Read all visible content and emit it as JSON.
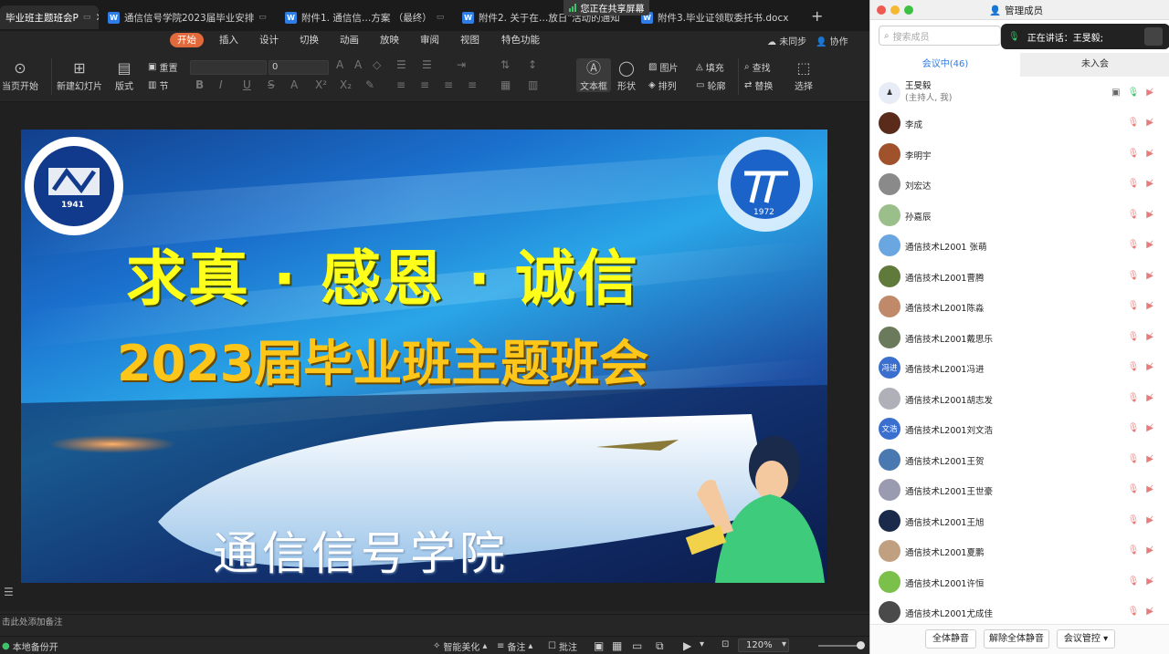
{
  "editor": {
    "tabs": [
      {
        "label": "毕业班主题班会P"
      },
      {
        "label": "通信信号学院2023届毕业安排"
      },
      {
        "label": "附件1. 通信信…方案 （最终）"
      },
      {
        "label": "附件2. 关于在…放日\"活动的通知"
      },
      {
        "label": "附件3.毕业证领取委托书.docx"
      }
    ],
    "share_badge": "您正在共享屏幕",
    "menu": [
      "开始",
      "插入",
      "设计",
      "切换",
      "动画",
      "放映",
      "审阅",
      "视图",
      "特色功能"
    ],
    "menu_right": {
      "sync": "未同步",
      "collab": "协作"
    },
    "ribbon": {
      "from_current": "当页开始",
      "new_slide": "新建幻灯片",
      "layout": "版式",
      "reset": "重置",
      "section": "节",
      "font_size": "0",
      "textbox": "文本框",
      "shape": "形状",
      "picture": "图片",
      "arrange": "排列",
      "fill": "填充",
      "outline": "轮廓",
      "find": "查找",
      "replace": "替换",
      "select": "选择"
    },
    "slide": {
      "title_big": "求真 · 感恩 · 诚信",
      "title_sub": "2023届毕业班主题班会",
      "college": "通信信号学院",
      "logo_left_year": "1941",
      "logo_right_year": "1972"
    },
    "notes_placeholder": "击此处添加备注",
    "status": {
      "backup": "本地备份开",
      "beautify": "智能美化",
      "notes": "备注",
      "comments": "批注",
      "zoom": "120%"
    }
  },
  "panel": {
    "title": "管理成员",
    "search_placeholder": "搜索成员",
    "speaking": "正在讲话：王旻毅;",
    "tab_in": "会议中(46)",
    "tab_out": "未入会",
    "host": {
      "name": "王旻毅",
      "role": "(主持人, 我)"
    },
    "members": [
      {
        "name": "李成",
        "avatar": "",
        "color": "#5a2a1a"
      },
      {
        "name": "李明宇",
        "avatar": "",
        "color": "#a0522d"
      },
      {
        "name": "刘宏达",
        "avatar": "",
        "color": "#8a8a8a"
      },
      {
        "name": "孙嘉辰",
        "avatar": "",
        "color": "#9bbf8a"
      },
      {
        "name": "通信技术L2001 张萌",
        "avatar": "",
        "color": "#6aa6e0"
      },
      {
        "name": "通信技术L2001曹腾",
        "avatar": "",
        "color": "#5f7a3a"
      },
      {
        "name": "通信技术L2001陈淼",
        "avatar": "",
        "color": "#c08a6a"
      },
      {
        "name": "通信技术L2001戴思乐",
        "avatar": "",
        "color": "#6a7a5a"
      },
      {
        "name": "通信技术L2001冯进",
        "avatar": "冯进",
        "color": "#3a6fd0"
      },
      {
        "name": "通信技术L2001胡志发",
        "avatar": "",
        "color": "#b0b0b8"
      },
      {
        "name": "通信技术L2001刘文浩",
        "avatar": "文浩",
        "color": "#3a6fd0"
      },
      {
        "name": "通信技术L2001王贺",
        "avatar": "",
        "color": "#4a78b0"
      },
      {
        "name": "通信技术L2001王世豪",
        "avatar": "",
        "color": "#9a9ab0"
      },
      {
        "name": "通信技术L2001王旭",
        "avatar": "",
        "color": "#1a2a4a"
      },
      {
        "name": "通信技术L2001夏鹏",
        "avatar": "",
        "color": "#c0a080"
      },
      {
        "name": "通信技术L2001许恒",
        "avatar": "",
        "color": "#7ac04a"
      },
      {
        "name": "通信技术L2001尤成佳",
        "avatar": "",
        "color": "#4a4a4a"
      }
    ],
    "footer": {
      "mute_all": "全体静音",
      "unmute_all": "解除全体静音",
      "control": "会议管控"
    }
  },
  "colors": {
    "accent": "#e06a3c",
    "link": "#2f7ce4",
    "slide_title": "#ffff1a",
    "slide_sub": "#ffc61a"
  }
}
